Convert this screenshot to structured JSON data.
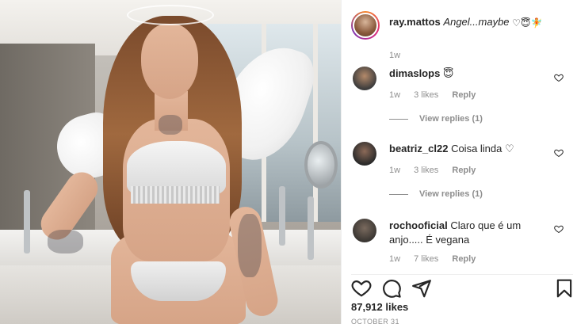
{
  "post": {
    "author": "ray.mattos",
    "caption": "Angel...maybe",
    "caption_emojis": [
      "♡",
      "😇",
      "🧚"
    ],
    "time": "1w"
  },
  "comments": [
    {
      "username": "dimaslops",
      "text": "😇",
      "time": "1w",
      "likes": "3 likes",
      "reply": "Reply",
      "view_replies": "View replies (1)"
    },
    {
      "username": "beatriz_cl22",
      "text": "Coisa linda ♡",
      "time": "1w",
      "likes": "3 likes",
      "reply": "Reply",
      "view_replies": "View replies (1)"
    },
    {
      "username": "rochooficial",
      "text": "Claro que é um anjo..... É vegana",
      "time": "1w",
      "likes": "7 likes",
      "reply": "Reply"
    }
  ],
  "stats": {
    "likes": "87,912 likes",
    "date": "OCTOBER 31"
  },
  "icons": [
    "heart-icon",
    "comment-icon",
    "share-icon",
    "bookmark-icon"
  ],
  "colors": {
    "text": "#262626",
    "muted": "#8e8e8e",
    "divider": "#efefef"
  }
}
